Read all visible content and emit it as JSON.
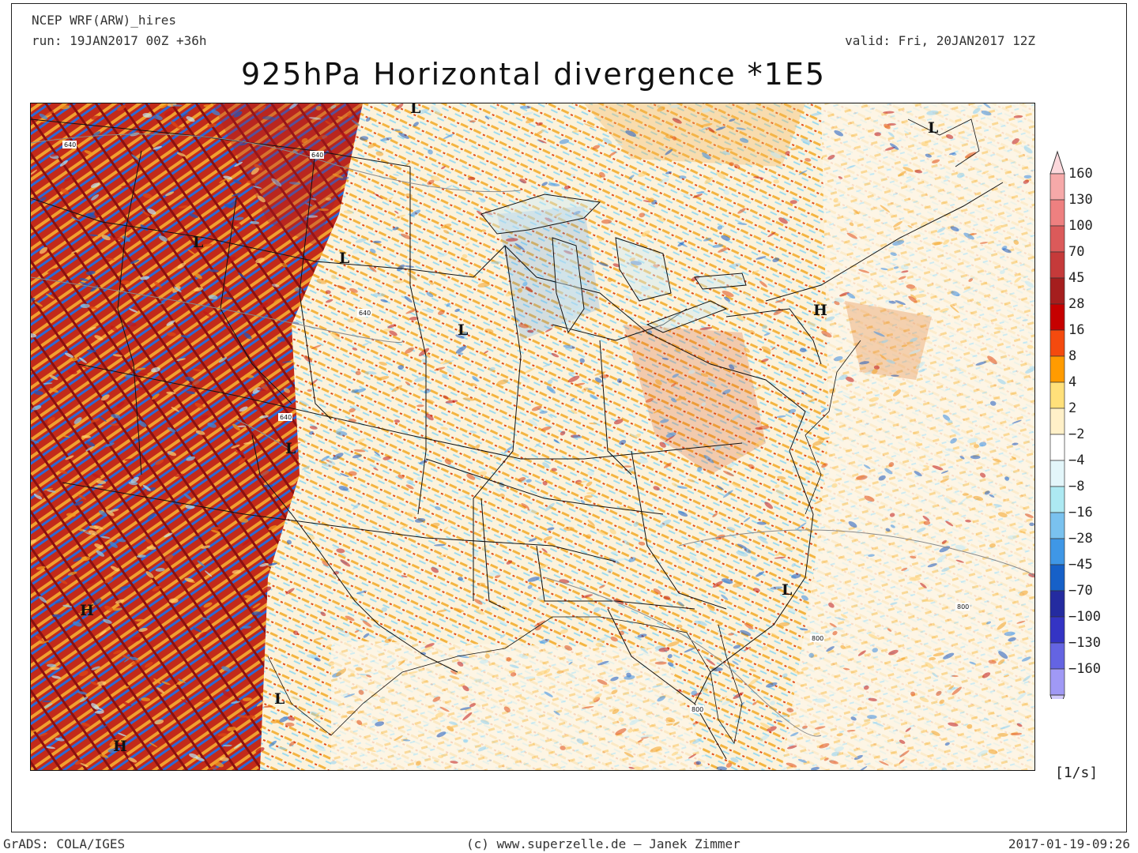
{
  "header": {
    "model": "NCEP WRF(ARW)_hires",
    "run": "run: 19JAN2017 00Z +36h",
    "valid": "valid: Fri, 20JAN2017 12Z",
    "title": "925hPa Horizontal divergence *1E5"
  },
  "colorbar": {
    "unit": "[1/s]",
    "levels": [
      {
        "label": "160",
        "color": "#f6a9a9"
      },
      {
        "label": "130",
        "color": "#ee8080"
      },
      {
        "label": "100",
        "color": "#db5a5a"
      },
      {
        "label": "70",
        "color": "#c53a3a"
      },
      {
        "label": "45",
        "color": "#a51e1e"
      },
      {
        "label": "28",
        "color": "#c60000"
      },
      {
        "label": "16",
        "color": "#f44a0e"
      },
      {
        "label": "8",
        "color": "#ff9b00"
      },
      {
        "label": "4",
        "color": "#ffe07a"
      },
      {
        "label": "2",
        "color": "#fff0c8"
      },
      {
        "label": "−2",
        "color": "#ffffff"
      },
      {
        "label": "−4",
        "color": "#e3f6fa"
      },
      {
        "label": "−8",
        "color": "#ade9f2"
      },
      {
        "label": "−16",
        "color": "#7ac2ef"
      },
      {
        "label": "−28",
        "color": "#3f97e6"
      },
      {
        "label": "−45",
        "color": "#1660c8"
      },
      {
        "label": "−70",
        "color": "#242ba0"
      },
      {
        "label": "−100",
        "color": "#3434c4"
      },
      {
        "label": "−130",
        "color": "#6464e2"
      },
      {
        "label": "−160",
        "color": "#a099f5"
      }
    ],
    "top_cap_color": "#fcd8dc",
    "bottom_cap_color": "#d2cbfb"
  },
  "map": {
    "pressure_systems": [
      {
        "type": "L",
        "label": "L"
      },
      {
        "type": "L",
        "label": "L"
      },
      {
        "type": "L",
        "label": "L"
      },
      {
        "type": "L",
        "label": "L"
      },
      {
        "type": "L",
        "label": "L"
      },
      {
        "type": "L",
        "label": "L"
      },
      {
        "type": "L",
        "label": "L"
      },
      {
        "type": "L",
        "label": "L"
      },
      {
        "type": "H",
        "label": "H"
      },
      {
        "type": "H",
        "label": "H"
      },
      {
        "type": "H",
        "label": "H"
      }
    ],
    "contour_labels": [
      "640",
      "640",
      "640",
      "640",
      "800",
      "800",
      "800"
    ]
  },
  "footer": {
    "left": "GrADS: COLA/IGES",
    "center": "(c) www.superzelle.de – Janek Zimmer",
    "right": "2017-01-19-09:26"
  }
}
